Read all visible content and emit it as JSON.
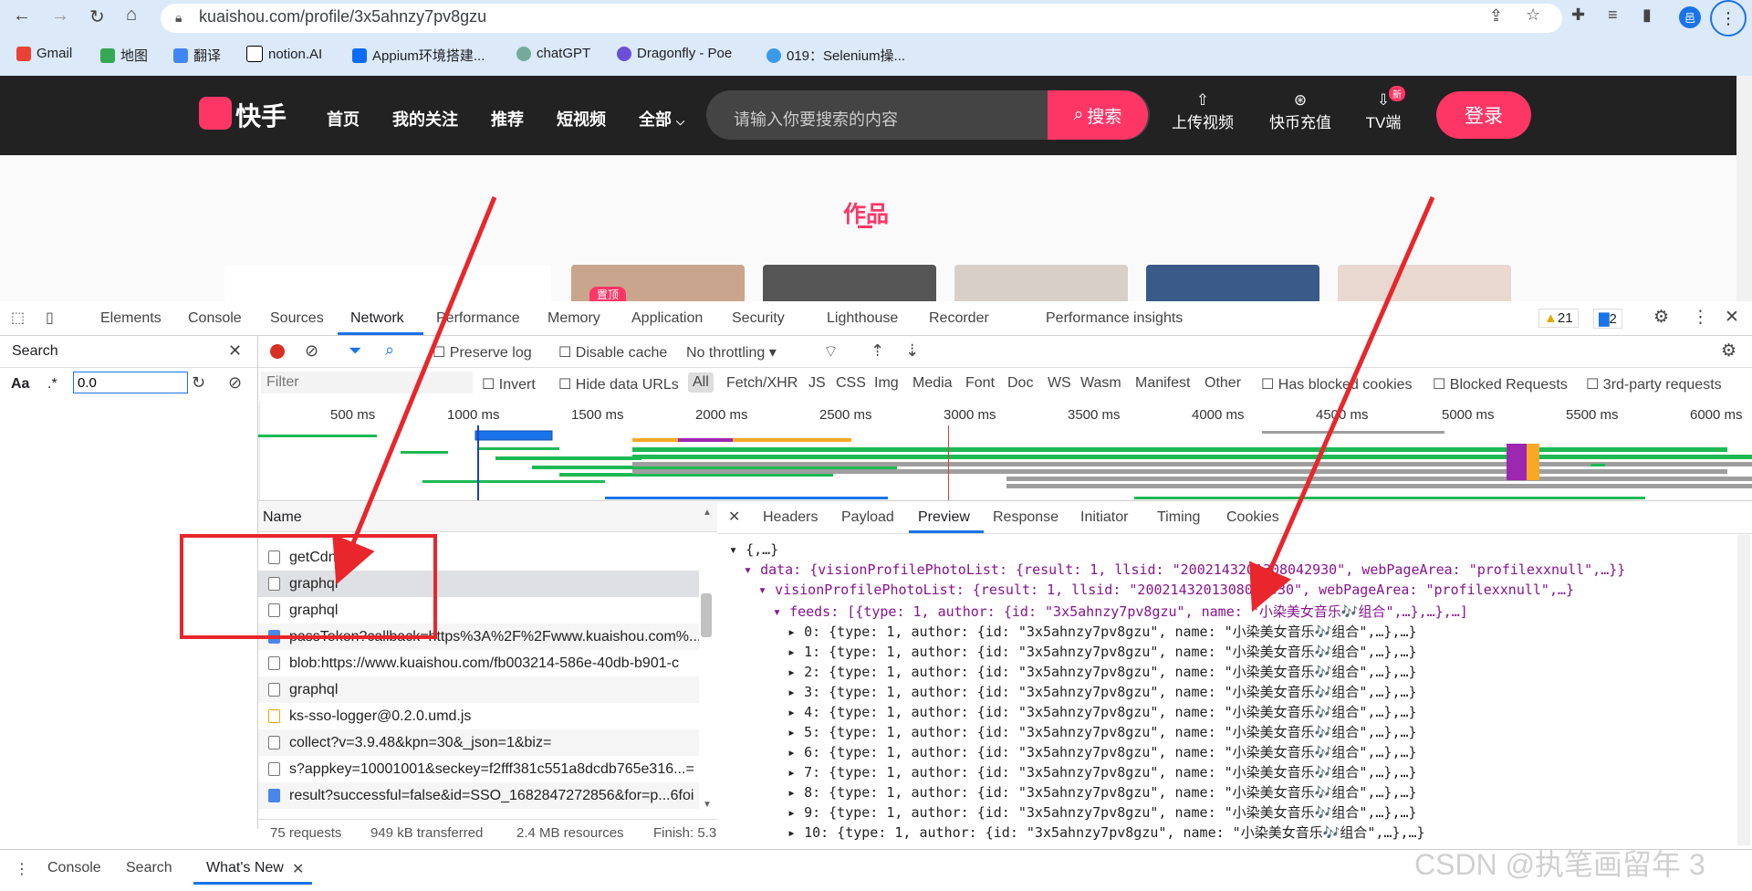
{
  "browser": {
    "url": "kuaishou.com/profile/3x5ahnzy7pv8gzu",
    "bookmarks": [
      "Gmail",
      "地图",
      "翻译",
      "notion.AI",
      "Appium环境搭建...",
      "chatGPT",
      "Dragonfly - Poe",
      "019：Selenium操..."
    ],
    "avatar_letter": "邑"
  },
  "site": {
    "logo": "快手",
    "nav": [
      "首页",
      "我的关注",
      "推荐",
      "短视频",
      "全部"
    ],
    "search_placeholder": "请输入你要搜索的内容",
    "search_button": "搜索",
    "upload": "上传视频",
    "recharge": "快币充值",
    "tv": "TV端",
    "tv_badge": "新",
    "login": "登录",
    "works_title": "作品",
    "pinned": "置顶"
  },
  "devtools": {
    "tabs": [
      "Elements",
      "Console",
      "Sources",
      "Network",
      "Performance",
      "Memory",
      "Application",
      "Security",
      "Lighthouse",
      "Recorder",
      "Performance insights"
    ],
    "active_tab": "Network",
    "warnings": "21",
    "messages": "2",
    "search_title": "Search",
    "search_aa": "Aa",
    "search_regex": ".*",
    "search_value": "0.0",
    "preserve_log": "Preserve log",
    "disable_cache": "Disable cache",
    "throttling": "No throttling",
    "filter_placeholder": "Filter",
    "invert": "Invert",
    "hide_data_urls": "Hide data URLs",
    "types": [
      "All",
      "Fetch/XHR",
      "JS",
      "CSS",
      "Img",
      "Media",
      "Font",
      "Doc",
      "WS",
      "Wasm",
      "Manifest",
      "Other"
    ],
    "has_blocked": "Has blocked cookies",
    "blocked_requests": "Blocked Requests",
    "third_party": "3rd-party requests",
    "ticks": [
      "500 ms",
      "1000 ms",
      "1500 ms",
      "2000 ms",
      "2500 ms",
      "3000 ms",
      "3500 ms",
      "4000 ms",
      "4500 ms",
      "5000 ms",
      "5500 ms",
      "6000 ms"
    ],
    "name_header": "Name",
    "requests": [
      {
        "name": "getCdn",
        "type": "doc"
      },
      {
        "name": "graphql",
        "type": "doc"
      },
      {
        "name": "graphql",
        "type": "doc"
      },
      {
        "name": "passToken?callback=https%3A%2F%2Fwww.kuaishou.com%...",
        "type": "script"
      },
      {
        "name": "blob:https://www.kuaishou.com/fb003214-586e-40db-b901-c",
        "type": "doc"
      },
      {
        "name": "graphql",
        "type": "doc"
      },
      {
        "name": "ks-sso-logger@0.2.0.umd.js",
        "type": "js"
      },
      {
        "name": "collect?v=3.9.48&kpn=30&_json=1&biz=",
        "type": "doc"
      },
      {
        "name": "s?appkey=10001001&seckey=f2fff381c551a8dcdb765e316...=",
        "type": "doc"
      },
      {
        "name": "result?successful=false&id=SSO_1682847272856&for=p...6foi",
        "type": "script"
      }
    ],
    "status": {
      "requests": "75 requests",
      "transferred": "949 kB transferred",
      "resources": "2.4 MB resources",
      "finish": "Finish: 5.3"
    },
    "preview_tabs": [
      "Headers",
      "Payload",
      "Preview",
      "Response",
      "Initiator",
      "Timing",
      "Cookies"
    ],
    "active_preview_tab": "Preview",
    "preview_lines": [
      "{,…}",
      "data: {visionProfilePhotoList: {result: 1, llsid: \"2002143201308042930\", webPageArea: \"profilexxnull\",…}}",
      "visionProfilePhotoList: {result: 1, llsid: \"2002143201308042930\", webPageArea: \"profilexxnull\",…}",
      "feeds: [{type: 1, author: {id: \"3x5ahnzy7pv8gzu\", name: \"小染美女音乐🎶组合\",…},…},…]",
      "0: {type: 1, author: {id: \"3x5ahnzy7pv8gzu\", name: \"小染美女音乐🎶组合\",…},…}",
      "1: {type: 1, author: {id: \"3x5ahnzy7pv8gzu\", name: \"小染美女音乐🎶组合\",…},…}",
      "2: {type: 1, author: {id: \"3x5ahnzy7pv8gzu\", name: \"小染美女音乐🎶组合\",…},…}",
      "3: {type: 1, author: {id: \"3x5ahnzy7pv8gzu\", name: \"小染美女音乐🎶组合\",…},…}",
      "4: {type: 1, author: {id: \"3x5ahnzy7pv8gzu\", name: \"小染美女音乐🎶组合\",…},…}",
      "5: {type: 1, author: {id: \"3x5ahnzy7pv8gzu\", name: \"小染美女音乐🎶组合\",…},…}",
      "6: {type: 1, author: {id: \"3x5ahnzy7pv8gzu\", name: \"小染美女音乐🎶组合\",…},…}",
      "7: {type: 1, author: {id: \"3x5ahnzy7pv8gzu\", name: \"小染美女音乐🎶组合\",…},…}",
      "8: {type: 1, author: {id: \"3x5ahnzy7pv8gzu\", name: \"小染美女音乐🎶组合\",…},…}",
      "9: {type: 1, author: {id: \"3x5ahnzy7pv8gzu\", name: \"小染美女音乐🎶组合\",…},…}",
      "10: {type: 1, author: {id: \"3x5ahnzy7pv8gzu\", name: \"小染美女音乐🎶组合\",…},…}"
    ],
    "drawer_tabs": [
      "Console",
      "Search",
      "What's New"
    ],
    "watermark": "CSDN @执笔画留年 3"
  },
  "colors": {
    "accent": "#fe3666",
    "devtools_blue": "#1a73e8",
    "annotation_red": "#e8262b"
  }
}
